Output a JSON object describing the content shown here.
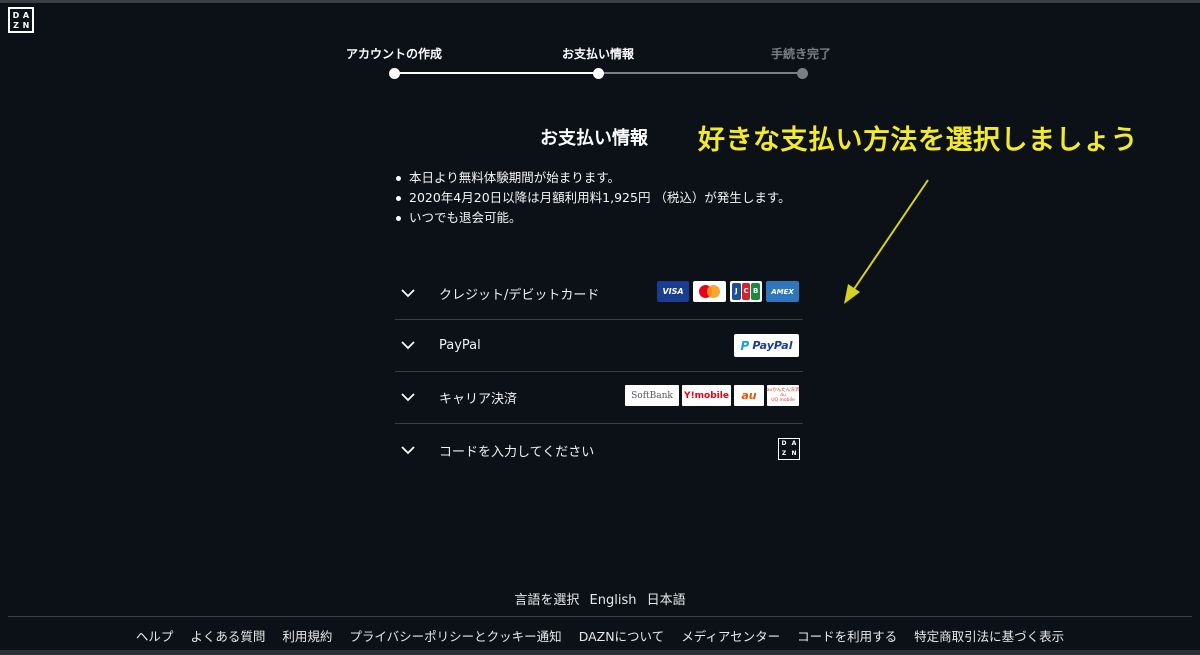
{
  "logo": {
    "letters": [
      "D",
      "A",
      "Z",
      "N"
    ]
  },
  "stepper": {
    "steps": [
      {
        "label": "アカウントの作成",
        "state": "done"
      },
      {
        "label": "お支払い情報",
        "state": "current"
      },
      {
        "label": "手続き完了",
        "state": "pending"
      }
    ]
  },
  "page": {
    "title": "お支払い情報"
  },
  "annotation": {
    "text": "好きな支払い方法を選択しましょう",
    "color": "#f3ea2b"
  },
  "notes": [
    "本日より無料体験期間が始まります。",
    "2020年4月20日以降は月額利用料1,925円 （税込）が発生します。",
    "いつでも退会可能。"
  ],
  "payment_methods": [
    {
      "label": "クレジット/デビットカード",
      "logos": [
        "VISA",
        "MasterCard",
        "JCB",
        "AMEX"
      ]
    },
    {
      "label": "PayPal",
      "logos": [
        "PayPal"
      ]
    },
    {
      "label": "キャリア決済",
      "logos": [
        "SoftBank",
        "Y!mobile",
        "au",
        "UQ mobile"
      ]
    },
    {
      "label": "コードを入力してください",
      "logos": [
        "DAZN"
      ]
    }
  ],
  "logo_text": {
    "visa": "VISA",
    "jcb": [
      "J",
      "C",
      "B"
    ],
    "amex": "AMEX",
    "paypal": "PayPal",
    "softbank": "SoftBank",
    "ymobile": "Y!mobile",
    "au": "au",
    "uq": [
      "auかんたん決済",
      "au",
      "UQ mobile"
    ]
  },
  "footer": {
    "language": {
      "label": "言語を選択",
      "options": [
        "English",
        "日本語"
      ]
    },
    "links": [
      "ヘルプ",
      "よくある質問",
      "利用規約",
      "プライバシーポリシーとクッキー通知",
      "DAZNについて",
      "メディアセンター",
      "コードを利用する",
      "特定商取引法に基づく表示"
    ]
  },
  "colors": {
    "background": "#0c1117",
    "accent": "#f3ea2b",
    "inactive": "#7b7f84"
  }
}
